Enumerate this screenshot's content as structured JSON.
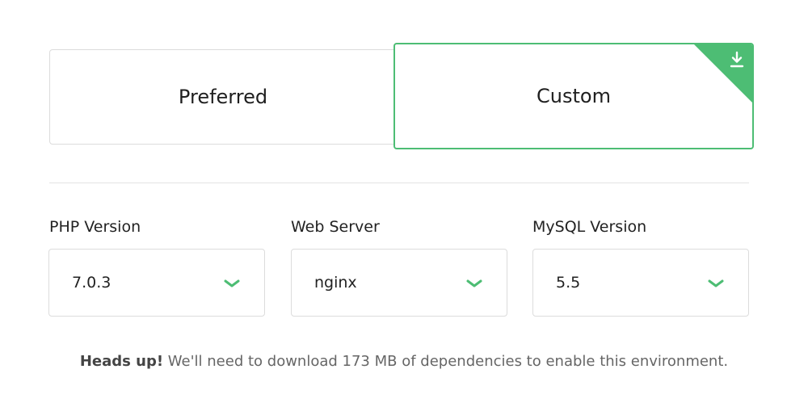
{
  "tabs": {
    "preferred_label": "Preferred",
    "custom_label": "Custom",
    "selected": "custom"
  },
  "fields": {
    "php": {
      "label": "PHP Version",
      "value": "7.0.3"
    },
    "web": {
      "label": "Web Server",
      "value": "nginx"
    },
    "mysql": {
      "label": "MySQL Version",
      "value": "5.5"
    }
  },
  "note": {
    "strong": "Heads up!",
    "text": " We'll need to download 173 MB of dependencies to enable this environment."
  },
  "colors": {
    "accent": "#4dbd74",
    "border": "#dcdcdc"
  },
  "icons": {
    "corner": "download-icon",
    "select": "chevron-down-icon"
  }
}
